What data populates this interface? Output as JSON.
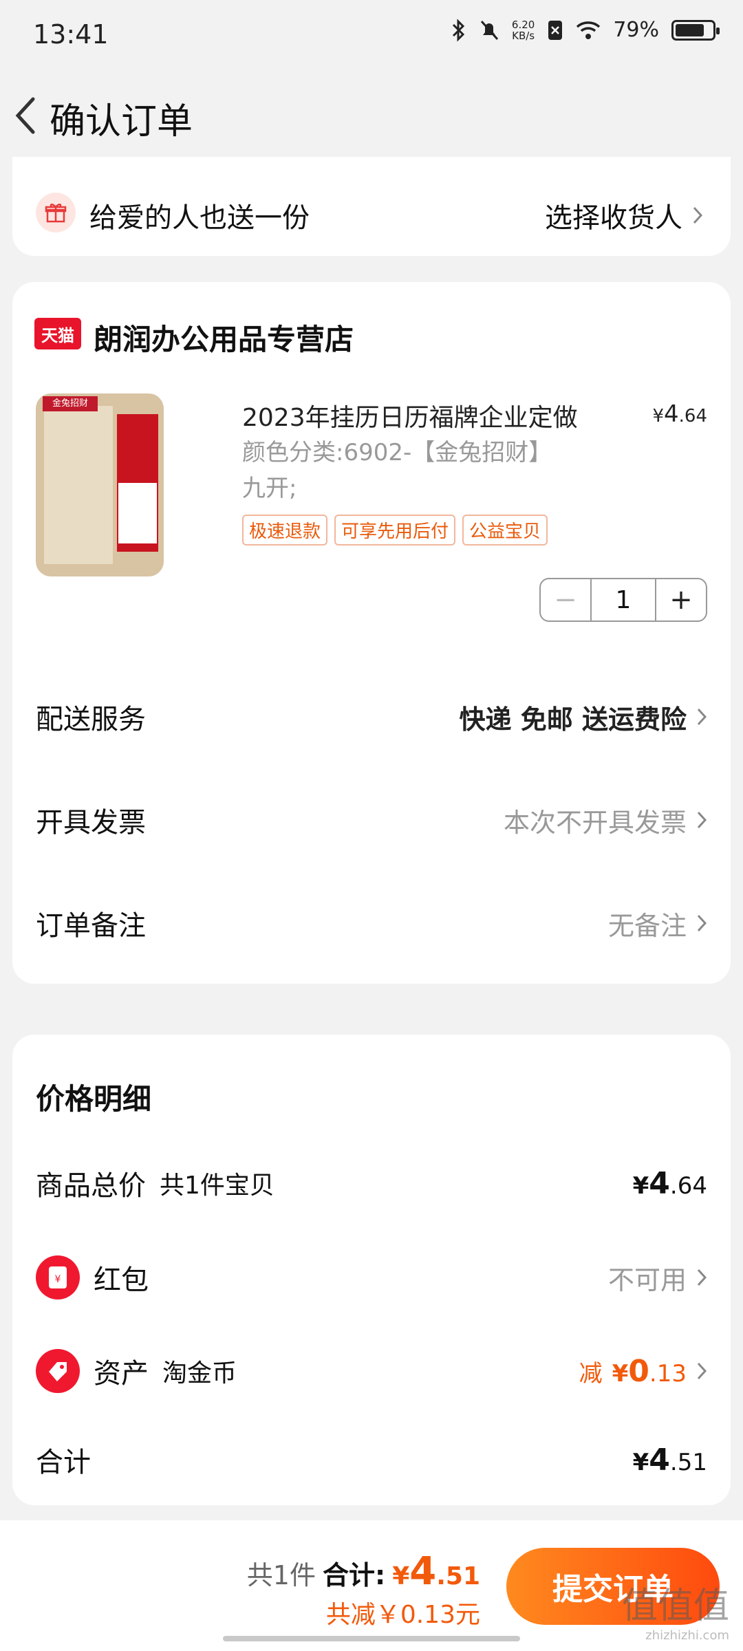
{
  "status_bar": {
    "time": "13:41",
    "net_speed_value": "6.20",
    "net_speed_unit": "KB/s",
    "battery": "79%",
    "battery_level": 0.79
  },
  "header": {
    "title": "确认订单"
  },
  "gift": {
    "text": "给爱的人也送一份",
    "action": "选择收货人"
  },
  "store": {
    "badge": "天猫",
    "name": "朗润办公用品专营店",
    "product": {
      "title": "2023年挂历日历福牌企业定做",
      "price_symbol": "¥",
      "price_int": "4",
      "price_dec": ".64",
      "spec_line1": "颜色分类:6902-【金兔招财】",
      "spec_line2": "九开;",
      "image_tag": "金兔招财",
      "tags": [
        "极速退款",
        "可享先用后付",
        "公益宝贝"
      ],
      "quantity": "1",
      "minus": "−",
      "plus": "+"
    },
    "rows": [
      {
        "label": "配送服务",
        "value": "快递 免邮 送运费险"
      },
      {
        "label": "开具发票",
        "value": "本次不开具发票"
      },
      {
        "label": "订单备注",
        "value": "无备注"
      }
    ]
  },
  "price_detail": {
    "title": "价格明细",
    "goods_total": {
      "label": "商品总价",
      "sub": "共1件宝贝",
      "symbol": "¥",
      "int": "4",
      "dec": ".64"
    },
    "red_packet": {
      "label": "红包",
      "value": "不可用"
    },
    "assets": {
      "label": "资产",
      "sub": "淘金币",
      "prefix": "减",
      "symbol": "¥",
      "int": "0",
      "dec": ".13"
    },
    "total": {
      "label": "合计",
      "symbol": "¥",
      "int": "4",
      "dec": ".51"
    }
  },
  "footer": {
    "count": "共1件",
    "total_label": "合计:",
    "total_symbol": "¥",
    "total_int": "4",
    "total_dec": ".51",
    "reduced": "共减￥0.13元",
    "submit": "提交订单"
  },
  "watermark": {
    "big": "值值值",
    "small": "zhizhizhi.com"
  },
  "colors": {
    "accent": "#f25a0b",
    "tmall_red": "#e8142b",
    "submit_gradient_start": "#ff8a1f",
    "submit_gradient_end": "#ff4a0e"
  }
}
